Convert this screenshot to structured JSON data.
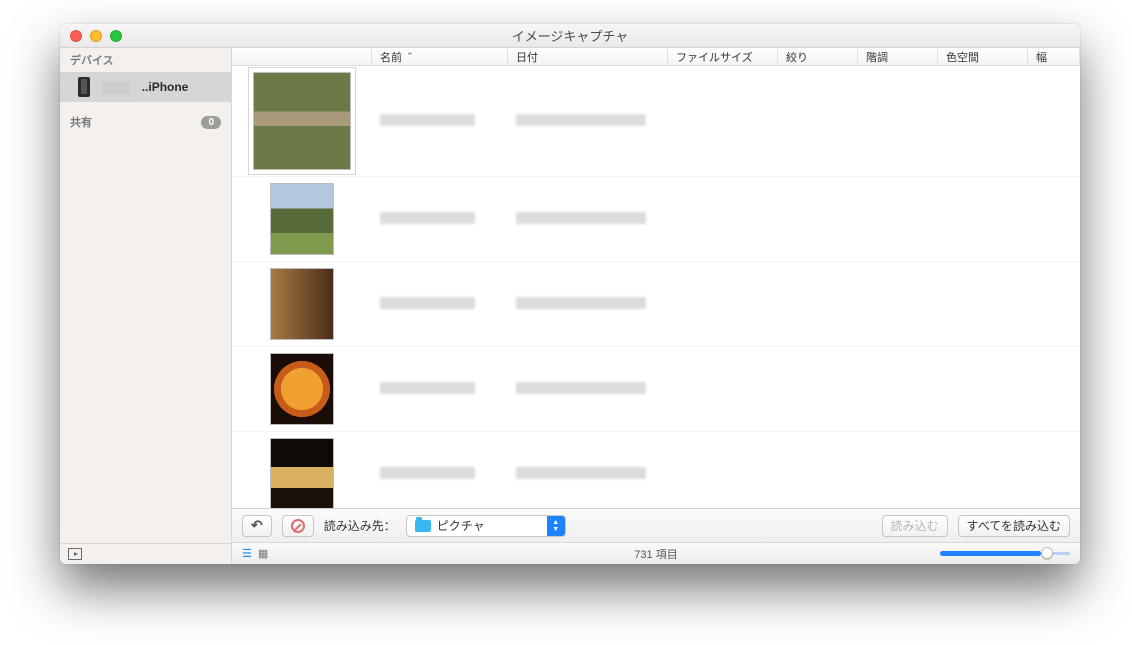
{
  "window": {
    "title": "イメージキャプチャ"
  },
  "sidebar": {
    "devices_label": "デバイス",
    "shared_label": "共有",
    "shared_count": "0",
    "device": {
      "name": "..iPhone"
    }
  },
  "columns": {
    "name": "名前",
    "date": "日付",
    "filesize": "ファイルサイズ",
    "aperture": "絞り",
    "tone": "階調",
    "colorspace": "色空間",
    "width": "幅"
  },
  "toolbar": {
    "import_to_label": "読み込み先：",
    "destination": "ピクチャ",
    "import_label": "読み込む",
    "import_all_label": "すべてを読み込む"
  },
  "status": {
    "item_count": "731 項目"
  }
}
